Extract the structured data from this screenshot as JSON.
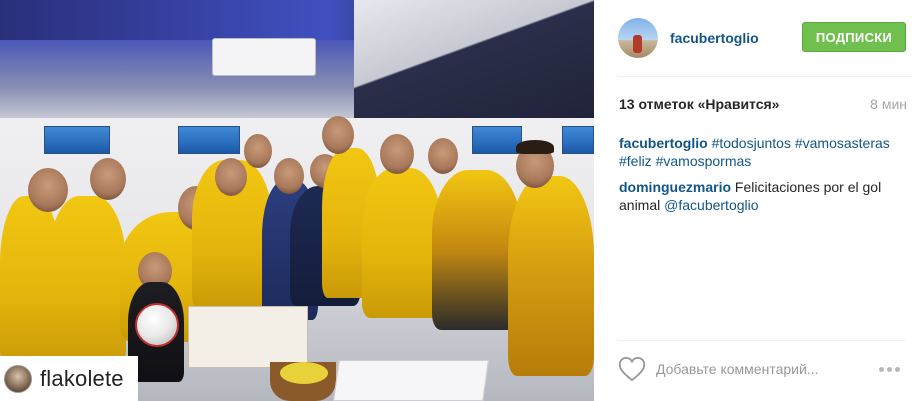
{
  "post": {
    "username": "facubertoglio",
    "follow_label": "ПОДПИСКИ",
    "likes_text": "13 отметок «Нравится»",
    "time_ago": "8 мин",
    "photo_tag": "flakolete",
    "comments": [
      {
        "user": "facubertoglio",
        "parts": [
          "#todosjuntos",
          "#vamosasteras",
          "#feliz",
          "#vamospormas"
        ]
      },
      {
        "user": "dominguezmario",
        "text": "Felicitaciones por el gol animal",
        "mention": "@facubertoglio"
      }
    ],
    "comment_placeholder": "Добавьте комментарий...",
    "icons": {
      "like": "heart-icon",
      "options": "more-options-icon"
    },
    "colors": {
      "follow_button": "#70c050",
      "username_link": "#125688",
      "jersey": "#f2c712"
    }
  }
}
